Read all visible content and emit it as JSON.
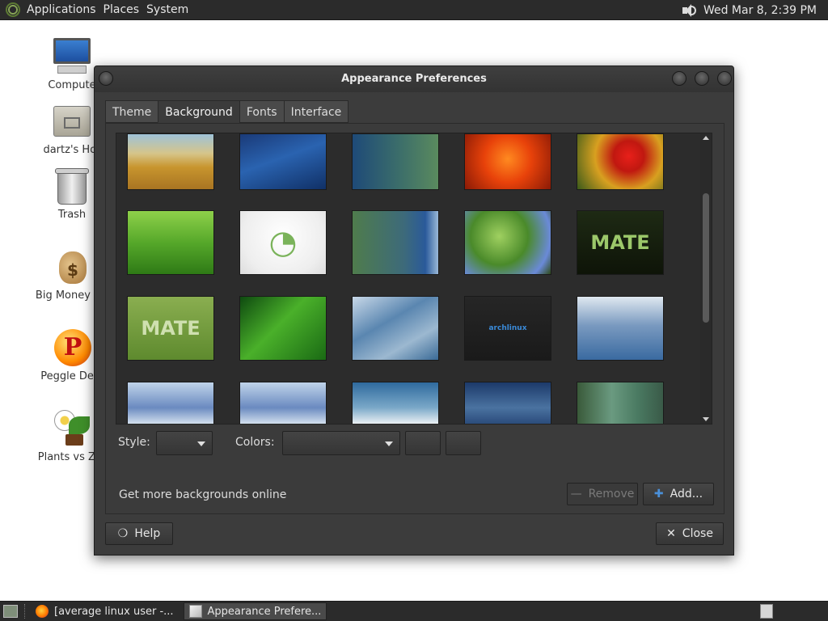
{
  "top_panel": {
    "menus": [
      "Applications",
      "Places",
      "System"
    ],
    "clock": "Wed Mar  8,  2:39 PM"
  },
  "desktop_icons": [
    {
      "label": "Compute",
      "icon": "computer-icon"
    },
    {
      "label": "dartz's Hor",
      "icon": "home-folder-icon"
    },
    {
      "label": "Trash",
      "icon": "trash-icon"
    },
    {
      "label": "Big Money De",
      "icon": "money-bag-icon"
    },
    {
      "label": "Peggle Delu",
      "icon": "peggle-icon"
    },
    {
      "label": "Plants vs Zor",
      "icon": "plants-vs-zombies-icon"
    }
  ],
  "dialog": {
    "title": "Appearance Preferences",
    "tabs": [
      {
        "label": "Theme",
        "active": false
      },
      {
        "label": "Background",
        "active": true
      },
      {
        "label": "Fonts",
        "active": false
      },
      {
        "label": "Interface",
        "active": false
      }
    ],
    "style_label": "Style:",
    "colors_label": "Colors:",
    "online_link": "Get more backgrounds online",
    "remove_label": "Remove",
    "add_label": "Add...",
    "help_label": "Help",
    "close_label": "Close",
    "thumbnails": [
      {
        "name": "dry-grass",
        "bg": "linear-gradient(180deg,#9ec2d8 0%,#d6c58a 35%,#c8952e 60%,#a87422 100%)"
      },
      {
        "name": "blue-drops",
        "bg": "linear-gradient(160deg,#1a3a78 0%,#2a63b0 45%,#103066 100%)"
      },
      {
        "name": "teal-gradient",
        "bg": "linear-gradient(90deg,#1e4a78 0%,#3c6e6a 55%,#5a8a5e 100%)"
      },
      {
        "name": "orange-flower",
        "bg": "radial-gradient(circle at 50% 45%,#ff8a20 0%,#e8420a 45%,#8a1a06 100%)"
      },
      {
        "name": "red-flower",
        "bg": "radial-gradient(circle at 60% 40%,#e8201a 0%,#c01810 25%,#d8a020 55%,#3a5a1a 100%)"
      },
      {
        "name": "green-grass",
        "bg": "linear-gradient(180deg,#8ed04a 0%,#56a82a 50%,#2f7a16 100%)"
      },
      {
        "name": "mate-white",
        "bg": "radial-gradient(circle at 50% 40%,#ffffff 0%,#eeeeee 70%,#dddddd 100%)",
        "text": "◔",
        "color": "#7ab35a"
      },
      {
        "name": "green-blue-waves",
        "bg": "linear-gradient(90deg,#4f7c4c 0%,#3d6a7a 60%,#2a5a9a 85%,#9ab8d8 100%)"
      },
      {
        "name": "bluebells",
        "bg": "radial-gradient(circle at 40% 40%,#9fd060 0%,#4a8a2a 45%,#6a8ad8 80%,#2f4a18 100%)"
      },
      {
        "name": "mate-dark",
        "bg": "linear-gradient(180deg,#1e2a14 0%,#0e1408 100%)",
        "text": "MATE",
        "color": "#9cc86a"
      },
      {
        "name": "mate-green",
        "bg": "linear-gradient(180deg,#8aae50 0%,#5e8a2e 100%)",
        "text": "MATE",
        "color": "#cfe0b0"
      },
      {
        "name": "green-leaf",
        "bg": "linear-gradient(135deg,#0e4a10 0%,#4ab02a 45%,#1a6a14 100%)"
      },
      {
        "name": "blue-waves",
        "bg": "linear-gradient(150deg,#c8d8e8 0%,#5a86b0 40%,#9cb8d0 70%,#3a6a96 100%)"
      },
      {
        "name": "arch-dark",
        "bg": "linear-gradient(180deg,#262626 0%,#1a1a1a 100%)",
        "text": "archlinux",
        "color": "#3a8ad8"
      },
      {
        "name": "ice-crystals",
        "bg": "linear-gradient(180deg,#dfe8f0 0%,#7a9ac0 45%,#3a6aa0 100%)"
      },
      {
        "name": "ice-row-1",
        "bg": "linear-gradient(180deg,#c0d4ea 0%,#6a8ac0 60%,#d8e4f0 100%)"
      },
      {
        "name": "ice-row-2",
        "bg": "linear-gradient(180deg,#c0d4ea 0%,#6a8ac0 60%,#d8e4f0 100%)"
      },
      {
        "name": "blue-sky-hills",
        "bg": "linear-gradient(180deg,#2f6a9e 0%,#7aa8c8 60%,#f0f4f6 100%)"
      },
      {
        "name": "blue-dunes",
        "bg": "linear-gradient(180deg,#1c3a6a 0%,#4a72a0 60%,#2a4a7a 100%)"
      },
      {
        "name": "green-curtain",
        "bg": "linear-gradient(90deg,#3a5a3a 0%,#6a9a80 40%,#4a7a62 70%,#3a5a48 100%)"
      }
    ]
  },
  "taskbar": {
    "tasks": [
      {
        "label": "[average linux user -...",
        "icon": "firefox-icon",
        "active": false
      },
      {
        "label": "Appearance Prefere...",
        "icon": "appearance-icon",
        "active": true
      }
    ]
  }
}
